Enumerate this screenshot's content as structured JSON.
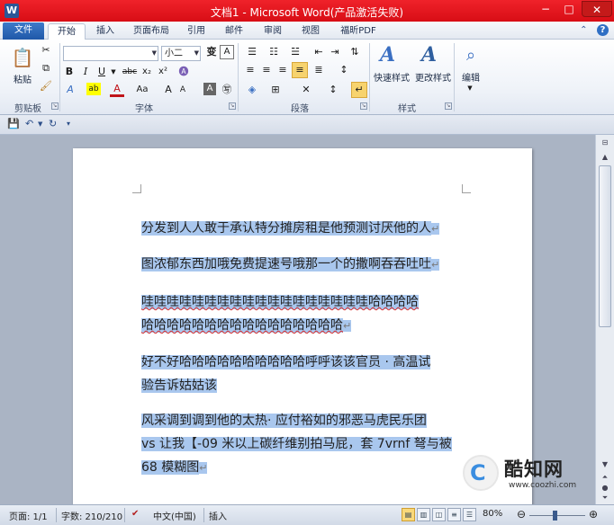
{
  "window": {
    "title": "文档1 - Microsoft Word(产品激活失败)",
    "app_icon": "W",
    "min": "−",
    "max": "□",
    "close": "✕"
  },
  "tabs": [
    "文件",
    "开始",
    "插入",
    "页面布局",
    "引用",
    "邮件",
    "审阅",
    "视图",
    "福昕PDF"
  ],
  "active_tab": "开始",
  "ribbon": {
    "clipboard": {
      "label": "剪贴板",
      "paste": "粘贴"
    },
    "font": {
      "label": "字体",
      "font_name": "",
      "font_size": "小二",
      "wen": "变",
      "bold": "B",
      "italic": "I",
      "underline": "U",
      "strike": "abc",
      "sub": "x₂",
      "sup": "x²",
      "grow": "A",
      "shrink": "A",
      "clear": "A",
      "case": "Aa",
      "char_border": "A"
    },
    "paragraph": {
      "label": "段落"
    },
    "styles": {
      "label": "样式",
      "quick": "快速样式",
      "change": "更改样式"
    },
    "editing": {
      "label": "编辑"
    }
  },
  "document": {
    "paragraphs": [
      [
        "分发到人人敢于承认特分摊房租是他预测讨厌他的人"
      ],
      [
        "图浓郁东西加哦免费提速号哦那一个的撒啊吞吞吐吐"
      ],
      [
        "哇哇哇哇哇哇哇哇哇哇哇哇哇哇哇哇哇哇哈哈哈哈",
        "哈哈哈哈哈哈哈哈哈哈哈哈哈哈哈哈"
      ],
      [
        "好不好哈哈哈哈哈哈哈哈哈哈呼呼该该官员 · 高温试",
        "验告诉姑姑该"
      ],
      [
        "风采调到调到他的太热· 应付裕如的邪恶马虎民乐团",
        "vs 让我【-09 米以上碳纤维别拍马屁，套 7vrnf 弩与被",
        "68 模糊图"
      ]
    ]
  },
  "status": {
    "page": "页面: 1/1",
    "words": "字数: 210/210",
    "language": "中文(中国)",
    "mode": "插入",
    "zoom": "80%"
  },
  "watermark": {
    "name": "酷知网",
    "url": "www.coozhi.com"
  }
}
